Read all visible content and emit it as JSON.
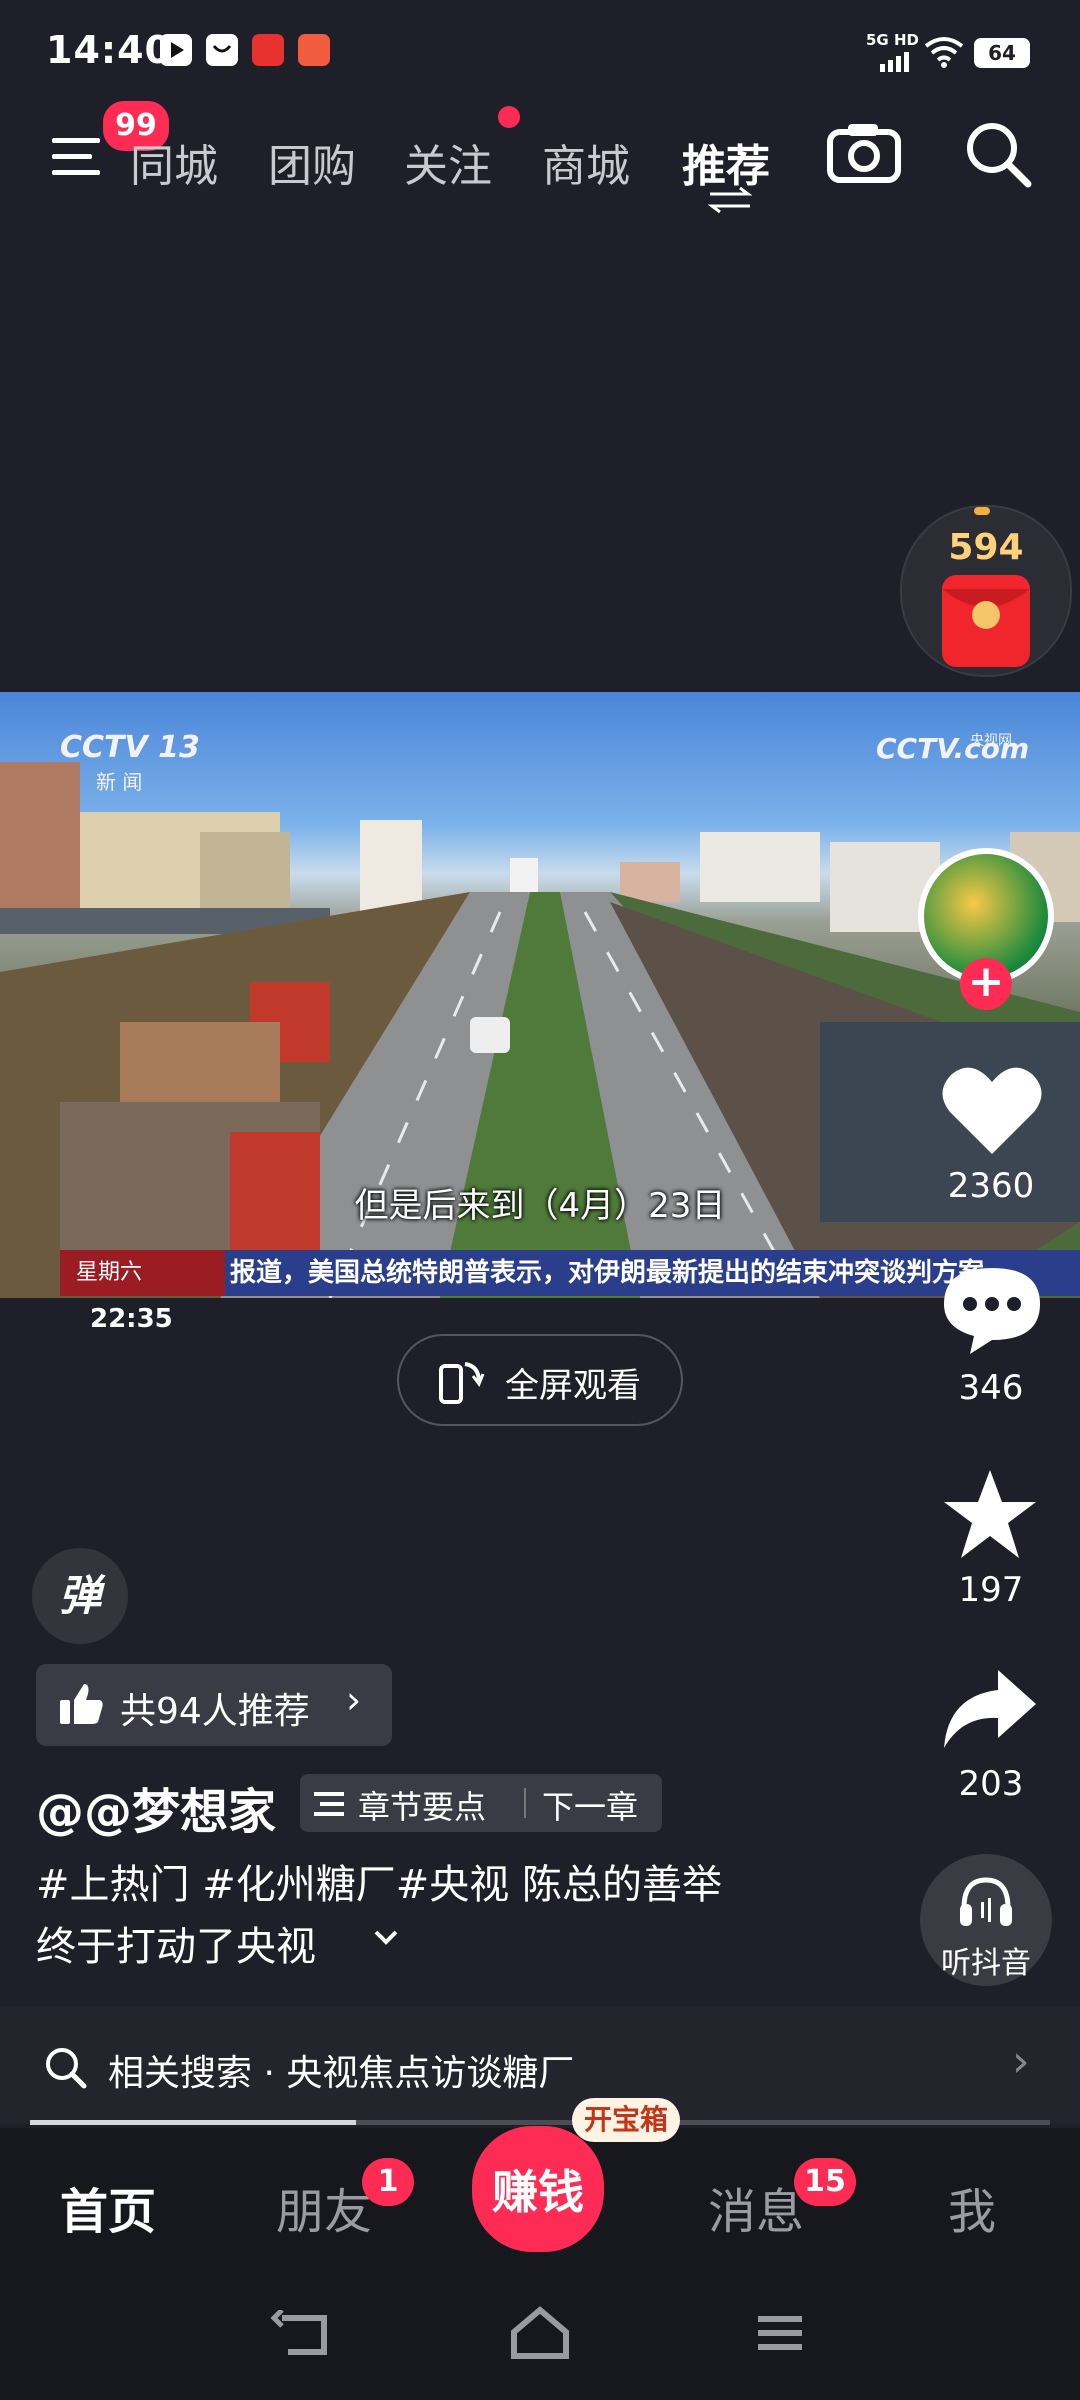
{
  "status_bar": {
    "time": "14:40",
    "network": "5G HD",
    "battery": "64"
  },
  "top_nav": {
    "menu_badge": "99",
    "tabs": [
      "同城",
      "团购",
      "关注",
      "商城",
      "推荐"
    ],
    "active_tab": "推荐"
  },
  "reward": {
    "value": "594"
  },
  "video": {
    "channel_logo": "CCTV 13",
    "channel_sub": "新 闻",
    "site_logo": "CCTV.com",
    "site_logo_small": "央视网",
    "subtitle": "但是后来到（4月）23日",
    "ticker_day": "星期六",
    "ticker_time": "22:35",
    "ticker_text": "报道，美国总统特朗普表示，对伊朗最新提出的结束冲突谈判方案"
  },
  "fullscreen": {
    "label": "全屏观看"
  },
  "actions": {
    "likes": "2360",
    "comments": "346",
    "favorites": "197",
    "shares": "203",
    "listen_label": "听抖音"
  },
  "danmaku": {
    "label": "弹"
  },
  "recommend": {
    "label": "共94人推荐"
  },
  "author": {
    "name": "@@梦想家"
  },
  "chapter": {
    "points_label": "章节要点",
    "next_label": "下一章"
  },
  "caption": {
    "line1": "#上热门 #化州糖厂#央视 陈总的善举",
    "line2": "终于打动了央视"
  },
  "related_search": {
    "prefix": "相关搜索",
    "dot": "·",
    "query": "央视焦点访谈糖厂"
  },
  "bottom_nav": {
    "items": [
      "首页",
      "朋友",
      "赚钱",
      "消息",
      "我"
    ],
    "friends_badge": "1",
    "messages_badge": "15",
    "treasure_label": "开宝箱"
  },
  "colors": {
    "accent": "#fe2c55",
    "background": "#1e1f28",
    "nav_bar": "#17181e"
  }
}
